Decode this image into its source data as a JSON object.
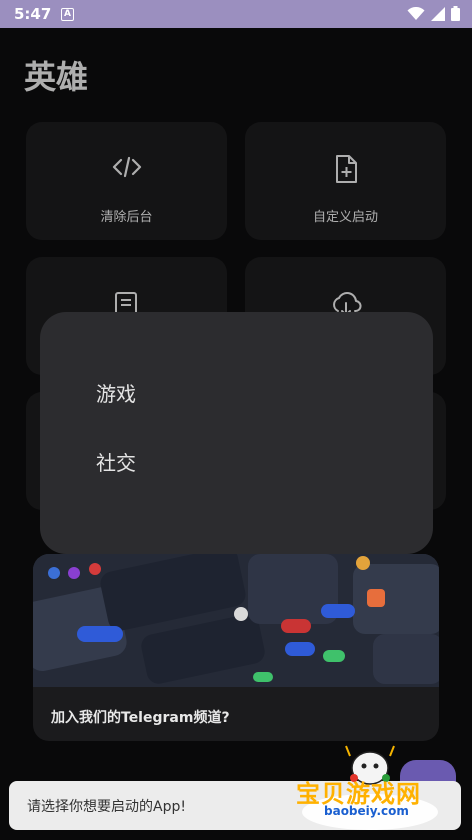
{
  "status_bar": {
    "time": "5:47",
    "notification_icon": "A"
  },
  "page": {
    "title": "英雄"
  },
  "grid": [
    {
      "label": "清除后台",
      "icon": "code-icon"
    },
    {
      "label": "自定义启动",
      "icon": "file-add-icon"
    },
    {
      "label": "",
      "icon": "document-icon"
    },
    {
      "label": "",
      "icon": "cloud-download-icon"
    }
  ],
  "dialog": {
    "items": [
      "游戏",
      "社交"
    ]
  },
  "banner": {
    "caption": "加入我们的Telegram频道?"
  },
  "toast": {
    "text": "请选择你想要启动的App!"
  },
  "watermark": {
    "title": "宝贝游戏网",
    "subtitle": "baobeiy.com"
  },
  "colors": {
    "status_bar": "#9b8fbf",
    "background": "#0d0d0e",
    "card": "#1b1b1d",
    "dialog": "#2c2c2f",
    "accent": "#6a5ab0"
  }
}
